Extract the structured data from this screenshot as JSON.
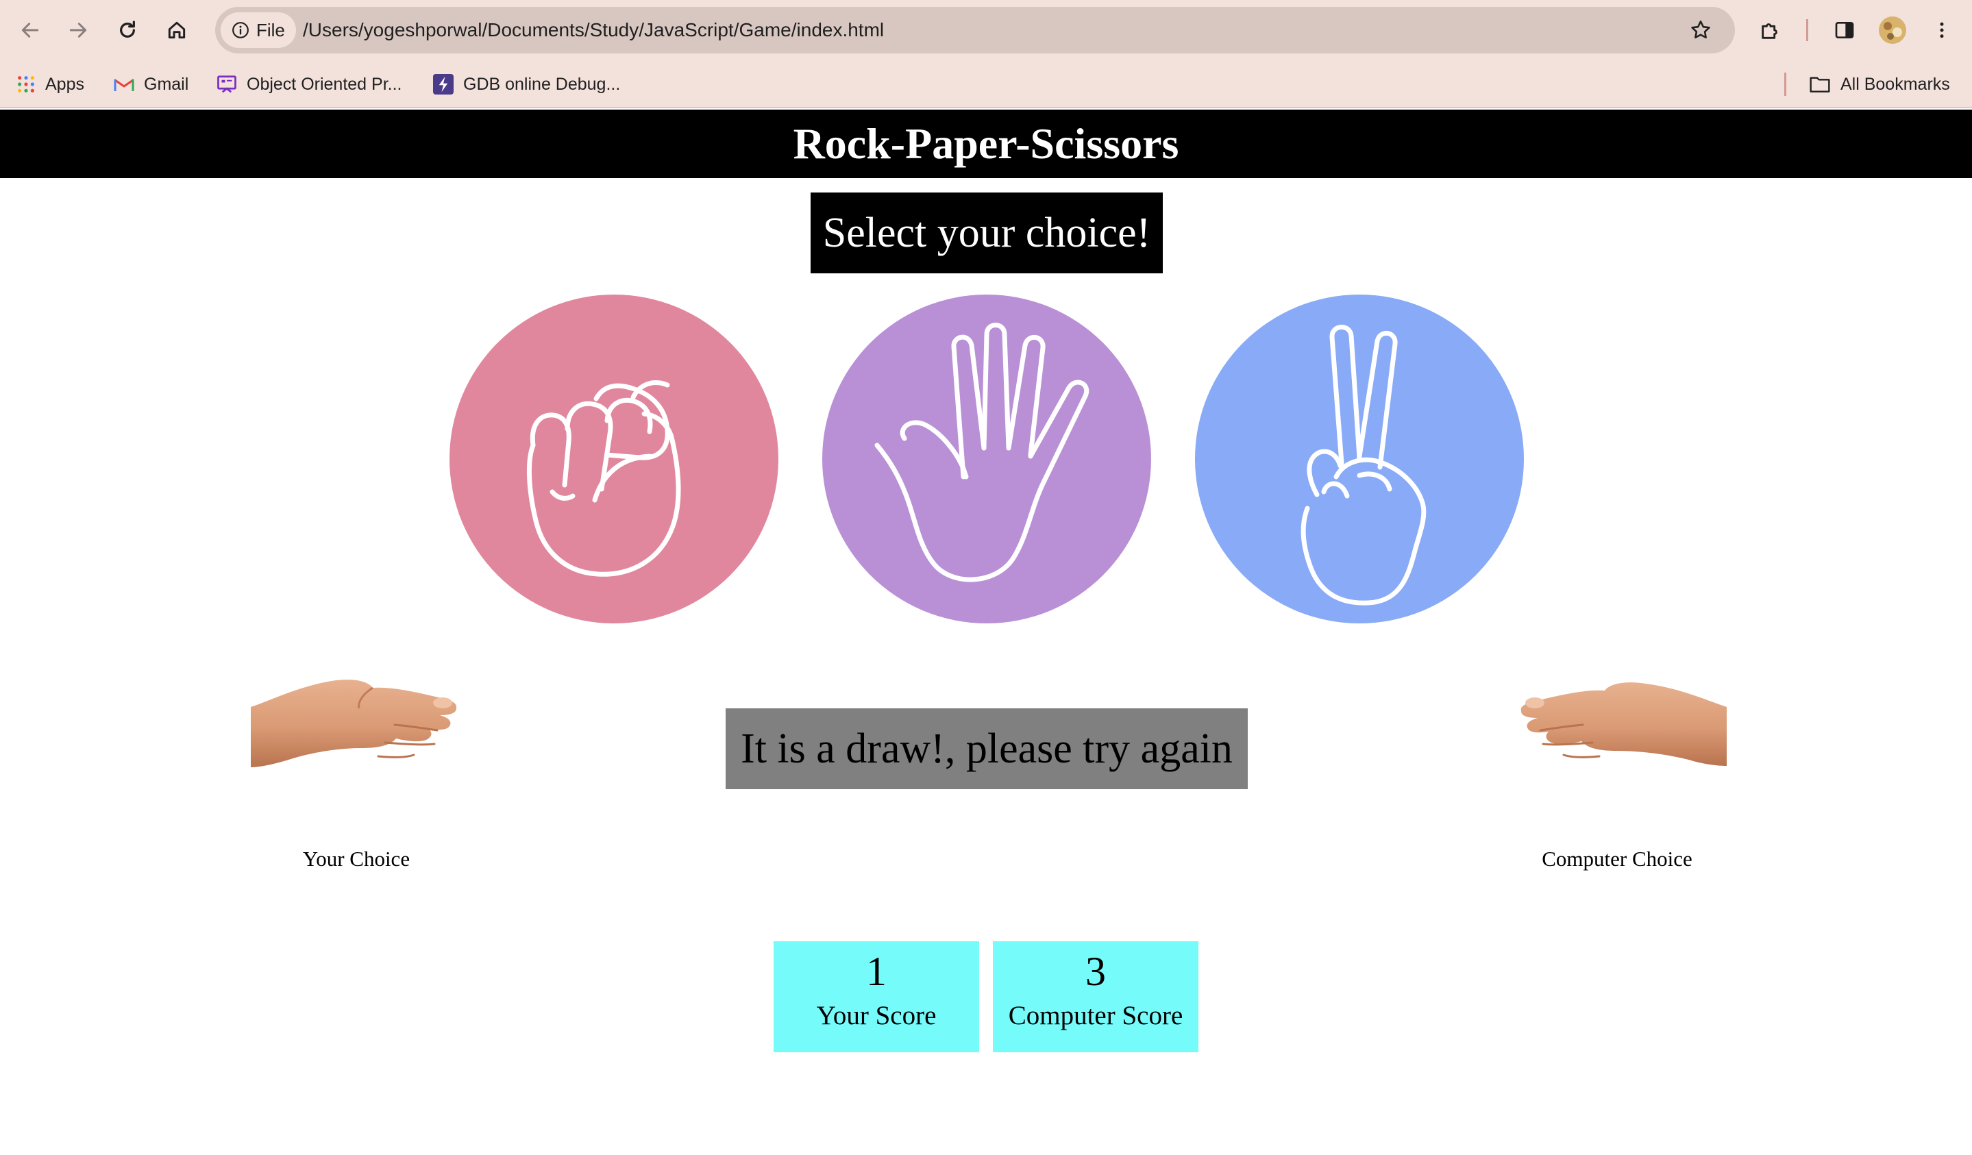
{
  "browser": {
    "url_chip": "File",
    "url": "/Users/yogeshporwal/Documents/Study/JavaScript/Game/index.html",
    "bookmarks": [
      {
        "label": "Apps",
        "icon": "apps-grid-icon"
      },
      {
        "label": "Gmail",
        "icon": "gmail-icon"
      },
      {
        "label": "Object Oriented Pr...",
        "icon": "presentation-icon"
      },
      {
        "label": "GDB online Debug...",
        "icon": "bolt-icon"
      }
    ],
    "all_bookmarks": "All Bookmarks"
  },
  "page": {
    "title": "Rock-Paper-Scissors",
    "message": "Select your choice!",
    "choices": [
      {
        "name": "rock",
        "color": "#e0879d"
      },
      {
        "name": "paper",
        "color": "#b990d6"
      },
      {
        "name": "scissors",
        "color": "#88aaf7"
      }
    ],
    "result": "It is a draw!, please try again",
    "your_choice_label": "Your Choice",
    "computer_choice_label": "Computer Choice",
    "scores": {
      "user_score": "1",
      "user_label": "Your Score",
      "computer_score": "3",
      "computer_label": "Computer Score"
    }
  }
}
